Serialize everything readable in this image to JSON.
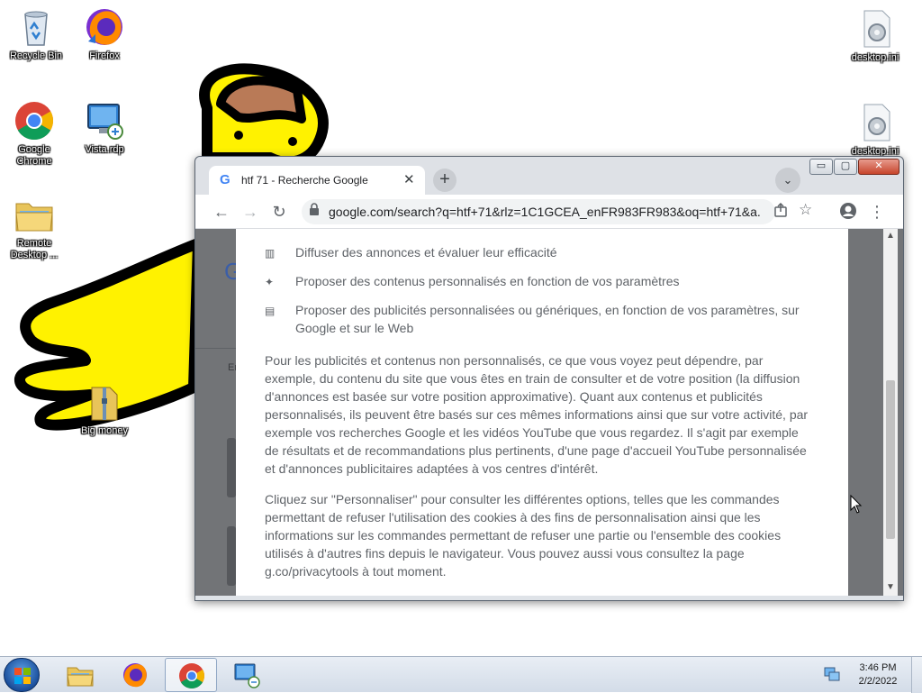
{
  "desktop": {
    "icons": [
      {
        "label": "Recycle Bin",
        "icon": "recycle-bin-icon"
      },
      {
        "label": "Firefox",
        "icon": "firefox-icon"
      },
      {
        "label": "Google Chrome",
        "icon": "chrome-icon"
      },
      {
        "label": "Vista.rdp",
        "icon": "rdp-file-icon"
      },
      {
        "label": "Remote Desktop ...",
        "icon": "folder-icon"
      },
      {
        "label": "Big money",
        "icon": "zip-folder-icon"
      },
      {
        "label": "desktop.ini",
        "icon": "settings-file-icon"
      },
      {
        "label": "desktop.ini",
        "icon": "settings-file-icon"
      }
    ]
  },
  "browser": {
    "tab": {
      "favicon": "G",
      "title": "htf 71 - Recherche Google",
      "close": "✕"
    },
    "new_tab": "+",
    "tab_search": "⌄",
    "window_buttons": {
      "minimize": "▭",
      "maximize": "▢",
      "close": "✕"
    },
    "toolbar": {
      "back": "←",
      "forward": "→",
      "reload": "↻",
      "profile": "●",
      "menu": "⋮"
    },
    "address": {
      "url": "google.com/search?q=htf+71&rlz=1C1GCEA_enFR983FR983&oq=htf+71&a..."
    },
    "page_background": {
      "logo_fragment": "G",
      "text_fragment": "Er"
    },
    "consent": {
      "options": [
        {
          "icon": "bar-chart-icon",
          "glyph": "▥",
          "text": "Diffuser des annonces et évaluer leur efficacité"
        },
        {
          "icon": "sparkle-icon",
          "glyph": "✦",
          "text": "Proposer des contenus personnalisés en fonction de vos paramètres"
        },
        {
          "icon": "ad-icon",
          "glyph": "▤",
          "text": "Proposer des publicités personnalisées ou génériques, en fonction de vos paramètres, sur Google et sur le Web"
        }
      ],
      "paragraph1": "Pour les publicités et contenus non personnalisés, ce que vous voyez peut dépendre, par exemple, du contenu du site que vous êtes en train de consulter et de votre position (la diffusion d'annonces est basée sur votre position approximative). Quant aux contenus et publicités personnalisés, ils peuvent être basés sur ces mêmes informations ainsi que sur votre activité, par exemple vos recherches Google et les vidéos YouTube que vous regardez. Il s'agit par exemple de résultats et de recommandations plus pertinents, d'une page d'accueil YouTube personnalisée et d'annonces publicitaires adaptées à vos centres d'intérêt.",
      "paragraph2": "Cliquez sur \"Personnaliser\" pour consulter les différentes options, telles que les commandes permettant de refuser l'utilisation des cookies à des fins de personnalisation ainsi que les informations sur les commandes permettant de refuser une partie ou l'ensemble des cookies utilisés à d'autres fins depuis le navigateur. Vous pouvez aussi vous consultez la page g.co/privacytools à tout moment."
    }
  },
  "taskbar": {
    "pinned": [
      {
        "icon": "explorer-icon",
        "active": false
      },
      {
        "icon": "firefox-icon",
        "active": false
      },
      {
        "icon": "chrome-icon",
        "active": true
      },
      {
        "icon": "rdp-icon",
        "active": false
      }
    ],
    "clock": {
      "time": "3:46 PM",
      "date": "2/2/2022"
    }
  },
  "colors": {
    "drawing_yellow": "#fff200",
    "drawing_outline": "#000000",
    "hair_brown": "#b97a57"
  }
}
